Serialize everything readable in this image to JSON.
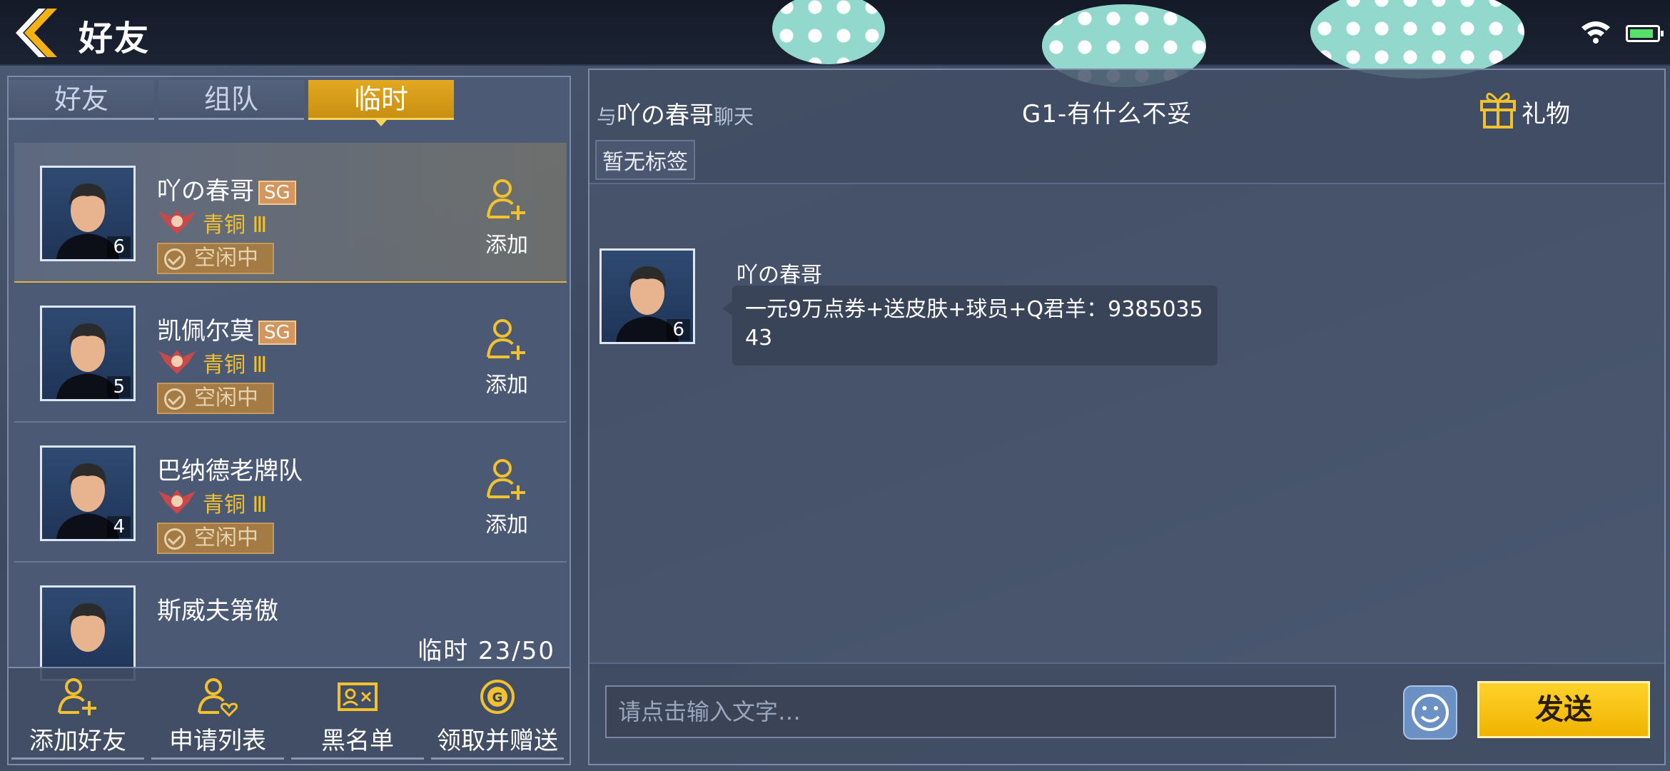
{
  "header": {
    "title": "好友"
  },
  "tabs": [
    {
      "label": "好友",
      "active": false
    },
    {
      "label": "组队",
      "active": false
    },
    {
      "label": "临时",
      "active": true
    }
  ],
  "friends": [
    {
      "name": "吖の春哥",
      "badge": "SG",
      "level": "6",
      "rank": "青铜 Ⅲ",
      "status": "空闲中",
      "action": "添加",
      "selected": true
    },
    {
      "name": "凯佩尔莫",
      "badge": "SG",
      "level": "5",
      "rank": "青铜 Ⅲ",
      "status": "空闲中",
      "action": "添加",
      "selected": false
    },
    {
      "name": "巴纳德老牌队",
      "badge": "",
      "level": "4",
      "rank": "青铜 Ⅲ",
      "status": "空闲中",
      "action": "添加",
      "selected": false
    },
    {
      "name": "斯威夫第傲",
      "badge": "",
      "level": "",
      "rank": "",
      "status": "",
      "action": "",
      "selected": false
    }
  ],
  "temp_count": "临时 23/50",
  "bottom_bar": [
    {
      "label": "添加好友",
      "icon": "add-friend-icon"
    },
    {
      "label": "申请列表",
      "icon": "request-list-icon"
    },
    {
      "label": "黑名单",
      "icon": "blacklist-icon"
    },
    {
      "label": "领取并赠送",
      "icon": "coin-gift-icon"
    }
  ],
  "chat": {
    "with_prefix": "与",
    "with_name": "吖の春哥",
    "with_suffix": "聊天",
    "title": "G1-有什么不妥",
    "gift_label": "礼物",
    "tag": "暂无标签",
    "messages": [
      {
        "sender": "吖の春哥",
        "level": "6",
        "text": "一元9万点券+送皮肤+球员+Q君羊：938503543"
      }
    ],
    "input_placeholder": "请点击输入文字…",
    "send_label": "发送"
  },
  "colors": {
    "accent": "#f0b400",
    "rank": "#f2c12e",
    "panel": "#4e5c78"
  }
}
